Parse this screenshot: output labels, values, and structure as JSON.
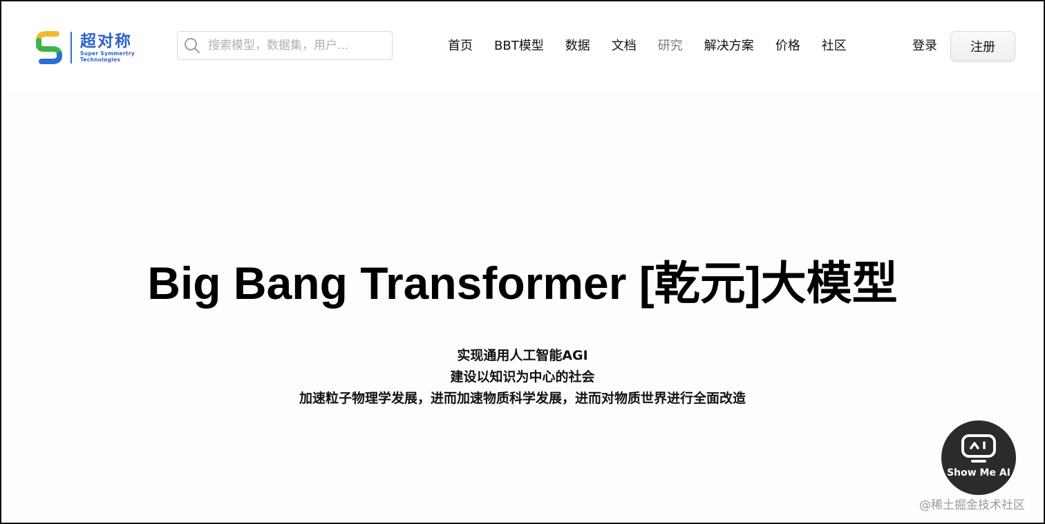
{
  "header": {
    "logo": {
      "name_cn": "超对称",
      "name_en_line1": "Super Symmertry",
      "name_en_line2": "Technologies"
    },
    "search": {
      "placeholder": "搜索模型，数据集，用户..."
    },
    "nav": [
      {
        "label": "首页"
      },
      {
        "label": "BBT模型"
      },
      {
        "label": "数据"
      },
      {
        "label": "文档"
      },
      {
        "label": "研究"
      },
      {
        "label": "解决方案"
      },
      {
        "label": "价格"
      },
      {
        "label": "社区"
      }
    ],
    "login_label": "登录",
    "signup_label": "注册"
  },
  "hero": {
    "title": "Big Bang Transformer [乾元]大模型",
    "lines": [
      "实现通用人工智能AGI",
      "建设以知识为中心的社会",
      "加速粒子物理学发展，进而加速物质科学发展，进而对物质世界进行全面改造"
    ]
  },
  "ai_button": {
    "label": "Show Me AI",
    "icon": "robot-face-icon"
  },
  "watermark": "@稀土掘金技术社区",
  "colors": {
    "brand_blue": "#2a5fcf",
    "logo_green": "#3bb54a",
    "logo_yellow": "#f5b82e",
    "logo_blue": "#2a6fd6",
    "muted_nav": "#7a7a7a",
    "ai_button_bg": "#2b2b2b"
  }
}
